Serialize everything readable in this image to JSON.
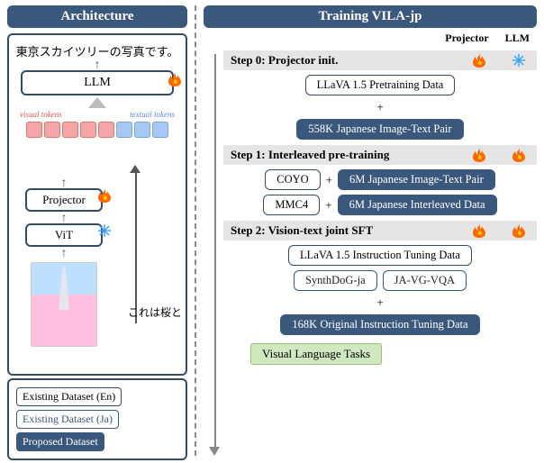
{
  "left_title": "Architecture",
  "right_title": "Training VILA-jp",
  "arch": {
    "output": "東京スカイツリーの写真です。",
    "llm": "LLM",
    "visual_tokens_label": "visual tokens",
    "textual_tokens_label": "textual tokens",
    "projector": "Projector",
    "vit": "ViT",
    "input": "これは桜と"
  },
  "legend": {
    "en": "Existing Dataset (En)",
    "ja": "Existing Dataset (Ja)",
    "prop": "Proposed Dataset"
  },
  "cols": {
    "projector": "Projector",
    "llm": "LLM"
  },
  "steps": {
    "s0": "Step 0: Projector init.",
    "s1": "Step 1: Interleaved pre-training",
    "s2": "Step 2: Vision-text joint SFT"
  },
  "datasets": {
    "llava_pre": "LLaVA 1.5 Pretraining Data",
    "jp_pair_558k": "558K Japanese Image-Text Pair",
    "coyo": "COYO",
    "jp_pair_6m": "6M Japanese Image-Text Pair",
    "mmc4": "MMC4",
    "jp_inter_6m": "6M Japanese Interleaved Data",
    "llava_inst": "LLaVA 1.5 Instruction Tuning Data",
    "synthdog": "SynthDoG-ja",
    "javgvqa": "JA-VG-VQA",
    "orig_inst_168k": "168K Original Instruction Tuning Data"
  },
  "task": "Visual Language Tasks",
  "plus": "+"
}
